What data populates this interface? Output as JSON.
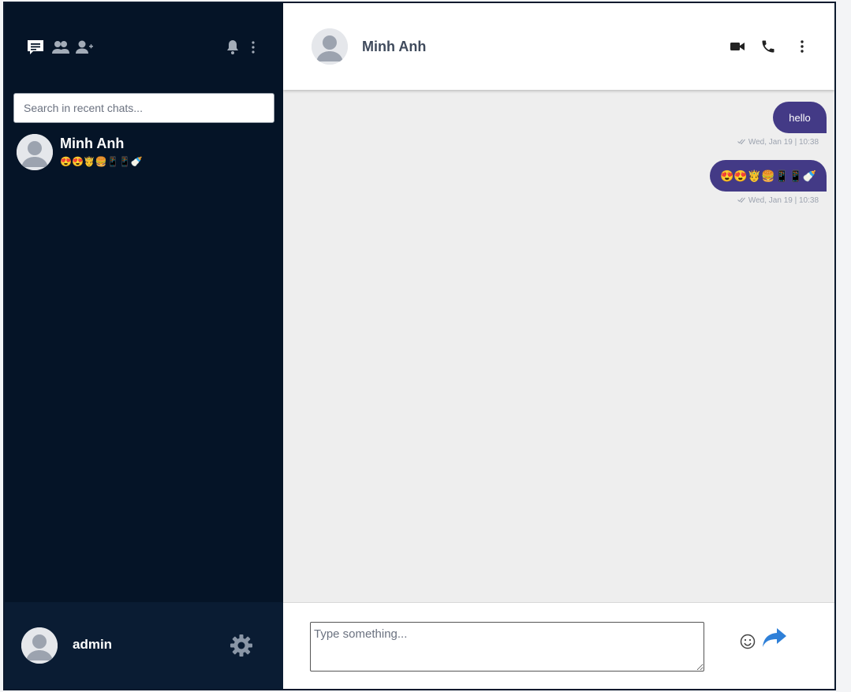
{
  "sidebar": {
    "search_placeholder": "Search in recent chats...",
    "icons": [
      "chat-icon",
      "group-icon",
      "add-user-icon",
      "bell-icon",
      "more-vertical-icon"
    ],
    "recent_chats": [
      {
        "name": "Minh Anh",
        "preview": "😍😍🤴🍔📱📱🍼"
      }
    ],
    "current_user": {
      "name": "admin"
    }
  },
  "conversation": {
    "contact_name": "Minh Anh",
    "messages": [
      {
        "text": "hello",
        "time": "Wed, Jan 19 | 10:38",
        "status": "delivered-check"
      },
      {
        "text": "😍😍🤴🍔📱📱🍼",
        "time": "Wed, Jan 19 | 10:38",
        "status": "delivered-check"
      }
    ],
    "composer_placeholder": "Type something..."
  },
  "colors": {
    "sidebar_bg": "#051427",
    "sidebar_footer_bg": "#0a1c33",
    "bubble": "#433a86",
    "send_icon": "#2f80d8",
    "chat_bg": "#eeeeee"
  }
}
